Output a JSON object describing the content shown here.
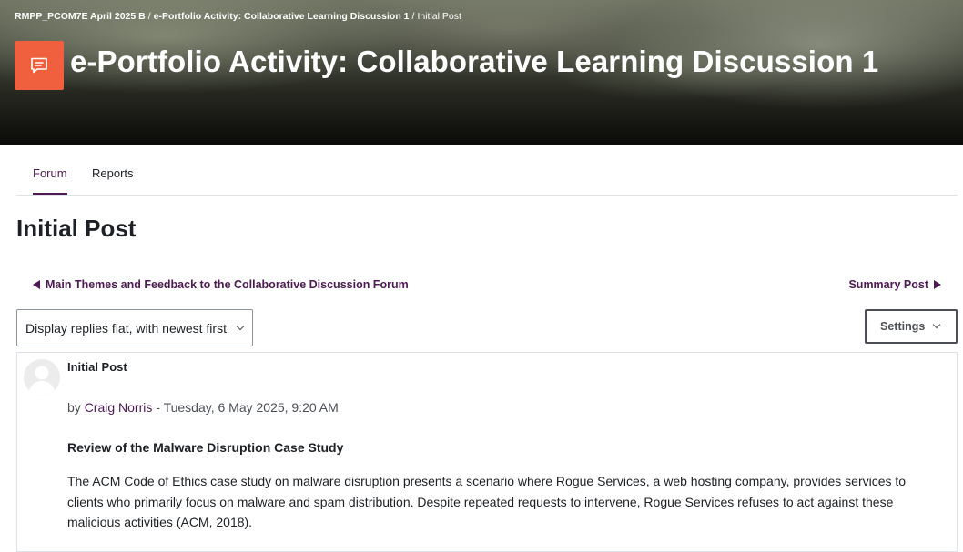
{
  "header": {
    "breadcrumb": {
      "course": "RMPP_PCOM7E April 2025 B",
      "activity": "e-Portfolio Activity: Collaborative Learning Discussion 1",
      "current": "Initial Post",
      "separator": "/"
    },
    "activity_icon": "forum-icon",
    "title": "e-Portfolio Activity: Collaborative Learning Discussion 1",
    "accent_color": "#f0603f"
  },
  "tabs": [
    {
      "label": "Forum",
      "active": true
    },
    {
      "label": "Reports",
      "active": false
    }
  ],
  "discussion": {
    "title": "Initial Post",
    "prev_link": "Main Themes and Feedback to the Collaborative Discussion Forum",
    "next_link": "Summary Post",
    "display_mode": "Display replies flat, with newest first",
    "settings_label": "Settings"
  },
  "post": {
    "subject": "Initial Post",
    "by_prefix": "by",
    "author": "Craig Norris",
    "date_separator": "-",
    "date": "Tuesday, 6 May 2025, 9:20 AM",
    "heading": "Review of the Malware Disruption Case Study",
    "body": "The ACM Code of Ethics case study on malware disruption presents a scenario where Rogue Services, a web hosting company, provides services to clients who primarily focus on malware and spam distribution. Despite repeated requests to intervene, Rogue Services refuses to act against these malicious activities (ACM, 2018)."
  },
  "colors": {
    "link": "#4e1a54",
    "text": "#1d2125",
    "muted": "#4b4f55"
  }
}
